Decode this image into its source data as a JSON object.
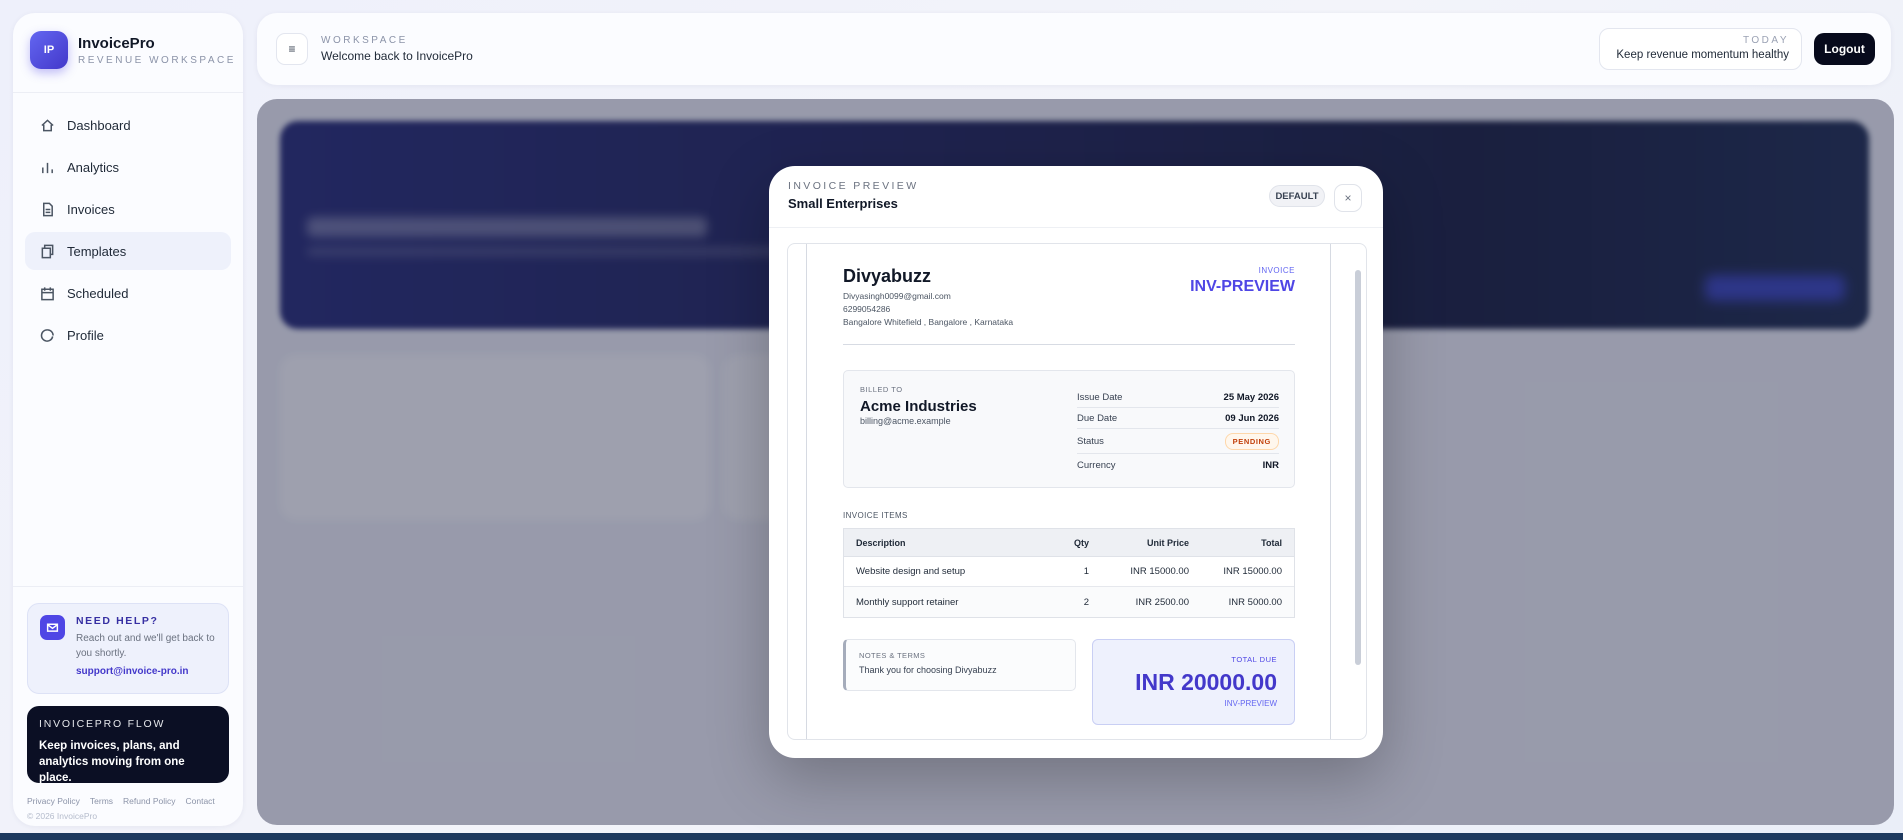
{
  "brand": {
    "logo": "IP",
    "name": "InvoicePro",
    "subtitle": "REVENUE WORKSPACE"
  },
  "sidebar": {
    "items": [
      {
        "label": "Dashboard",
        "icon": "home-icon",
        "active": false
      },
      {
        "label": "Analytics",
        "icon": "bar-chart-icon",
        "active": false
      },
      {
        "label": "Invoices",
        "icon": "file-icon",
        "active": false
      },
      {
        "label": "Templates",
        "icon": "copy-icon",
        "active": true
      },
      {
        "label": "Scheduled",
        "icon": "calendar-icon",
        "active": false
      },
      {
        "label": "Profile",
        "icon": "profile-icon",
        "active": false
      }
    ],
    "help": {
      "title": "NEED HELP?",
      "text": "Reach out and we'll get back to you shortly.",
      "email": "support@invoice-pro.in"
    },
    "flow": {
      "title": "INVOICEPRO FLOW",
      "text": "Keep invoices, plans, and analytics moving from one place."
    },
    "footer": {
      "links": [
        "Privacy Policy",
        "Terms",
        "Refund Policy",
        "Contact"
      ],
      "copyright": "© 2026 InvoicePro"
    }
  },
  "header": {
    "workspace_label": "WORKSPACE",
    "welcome": "Welcome back to InvoicePro",
    "today_label": "TODAY",
    "today_text": "Keep revenue momentum healthy",
    "logout": "Logout"
  },
  "modal": {
    "label": "INVOICE PREVIEW",
    "title": "Small Enterprises",
    "badge": "DEFAULT",
    "close": "×"
  },
  "invoice": {
    "company": "Divyabuzz",
    "email": "Divyasingh0099@gmail.com",
    "phone": "6299054286",
    "address": "Bangalore Whitefield , Bangalore , Karnataka",
    "tag": "INVOICE",
    "number": "INV-PREVIEW",
    "billed_to_label": "BILLED TO",
    "client_name": "Acme Industries",
    "client_email": "billing@acme.example",
    "meta": [
      {
        "label": "Issue Date",
        "value": "25 May 2026"
      },
      {
        "label": "Due Date",
        "value": "09 Jun 2026"
      },
      {
        "label": "Status",
        "value": "PENDING"
      },
      {
        "label": "Currency",
        "value": "INR"
      }
    ],
    "items_label": "INVOICE ITEMS",
    "columns": [
      "Description",
      "Qty",
      "Unit Price",
      "Total"
    ],
    "items": [
      {
        "description": "Website design and setup",
        "qty": "1",
        "unit_price": "INR 15000.00",
        "total": "INR 15000.00"
      },
      {
        "description": "Monthly support retainer",
        "qty": "2",
        "unit_price": "INR 2500.00",
        "total": "INR 5000.00"
      }
    ],
    "notes_label": "NOTES & TERMS",
    "notes_text": "Thank you for choosing Divyabuzz",
    "total_label": "TOTAL DUE",
    "total_amount": "INR 20000.00",
    "total_ref": "INV-PREVIEW"
  },
  "colors": {
    "accent": "#4f46e5",
    "dark": "#0b0f24",
    "status_pending": "#c2410c"
  }
}
